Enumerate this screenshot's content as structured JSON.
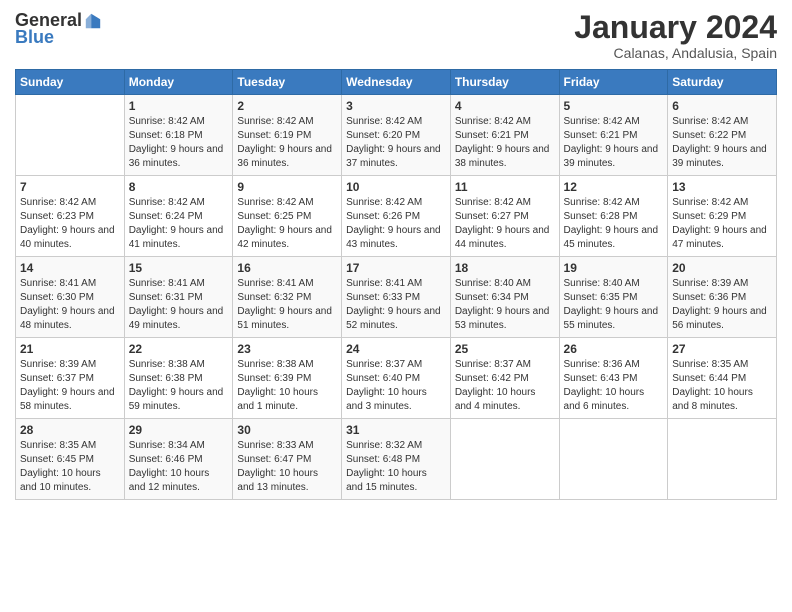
{
  "logo": {
    "general": "General",
    "blue": "Blue"
  },
  "title": "January 2024",
  "location": "Calanas, Andalusia, Spain",
  "weekdays": [
    "Sunday",
    "Monday",
    "Tuesday",
    "Wednesday",
    "Thursday",
    "Friday",
    "Saturday"
  ],
  "weeks": [
    [
      {
        "day": "",
        "empty": true
      },
      {
        "day": "1",
        "sunrise": "Sunrise: 8:42 AM",
        "sunset": "Sunset: 6:18 PM",
        "daylight": "Daylight: 9 hours and 36 minutes."
      },
      {
        "day": "2",
        "sunrise": "Sunrise: 8:42 AM",
        "sunset": "Sunset: 6:19 PM",
        "daylight": "Daylight: 9 hours and 36 minutes."
      },
      {
        "day": "3",
        "sunrise": "Sunrise: 8:42 AM",
        "sunset": "Sunset: 6:20 PM",
        "daylight": "Daylight: 9 hours and 37 minutes."
      },
      {
        "day": "4",
        "sunrise": "Sunrise: 8:42 AM",
        "sunset": "Sunset: 6:21 PM",
        "daylight": "Daylight: 9 hours and 38 minutes."
      },
      {
        "day": "5",
        "sunrise": "Sunrise: 8:42 AM",
        "sunset": "Sunset: 6:21 PM",
        "daylight": "Daylight: 9 hours and 39 minutes."
      },
      {
        "day": "6",
        "sunrise": "Sunrise: 8:42 AM",
        "sunset": "Sunset: 6:22 PM",
        "daylight": "Daylight: 9 hours and 39 minutes."
      }
    ],
    [
      {
        "day": "7",
        "sunrise": "Sunrise: 8:42 AM",
        "sunset": "Sunset: 6:23 PM",
        "daylight": "Daylight: 9 hours and 40 minutes."
      },
      {
        "day": "8",
        "sunrise": "Sunrise: 8:42 AM",
        "sunset": "Sunset: 6:24 PM",
        "daylight": "Daylight: 9 hours and 41 minutes."
      },
      {
        "day": "9",
        "sunrise": "Sunrise: 8:42 AM",
        "sunset": "Sunset: 6:25 PM",
        "daylight": "Daylight: 9 hours and 42 minutes."
      },
      {
        "day": "10",
        "sunrise": "Sunrise: 8:42 AM",
        "sunset": "Sunset: 6:26 PM",
        "daylight": "Daylight: 9 hours and 43 minutes."
      },
      {
        "day": "11",
        "sunrise": "Sunrise: 8:42 AM",
        "sunset": "Sunset: 6:27 PM",
        "daylight": "Daylight: 9 hours and 44 minutes."
      },
      {
        "day": "12",
        "sunrise": "Sunrise: 8:42 AM",
        "sunset": "Sunset: 6:28 PM",
        "daylight": "Daylight: 9 hours and 45 minutes."
      },
      {
        "day": "13",
        "sunrise": "Sunrise: 8:42 AM",
        "sunset": "Sunset: 6:29 PM",
        "daylight": "Daylight: 9 hours and 47 minutes."
      }
    ],
    [
      {
        "day": "14",
        "sunrise": "Sunrise: 8:41 AM",
        "sunset": "Sunset: 6:30 PM",
        "daylight": "Daylight: 9 hours and 48 minutes."
      },
      {
        "day": "15",
        "sunrise": "Sunrise: 8:41 AM",
        "sunset": "Sunset: 6:31 PM",
        "daylight": "Daylight: 9 hours and 49 minutes."
      },
      {
        "day": "16",
        "sunrise": "Sunrise: 8:41 AM",
        "sunset": "Sunset: 6:32 PM",
        "daylight": "Daylight: 9 hours and 51 minutes."
      },
      {
        "day": "17",
        "sunrise": "Sunrise: 8:41 AM",
        "sunset": "Sunset: 6:33 PM",
        "daylight": "Daylight: 9 hours and 52 minutes."
      },
      {
        "day": "18",
        "sunrise": "Sunrise: 8:40 AM",
        "sunset": "Sunset: 6:34 PM",
        "daylight": "Daylight: 9 hours and 53 minutes."
      },
      {
        "day": "19",
        "sunrise": "Sunrise: 8:40 AM",
        "sunset": "Sunset: 6:35 PM",
        "daylight": "Daylight: 9 hours and 55 minutes."
      },
      {
        "day": "20",
        "sunrise": "Sunrise: 8:39 AM",
        "sunset": "Sunset: 6:36 PM",
        "daylight": "Daylight: 9 hours and 56 minutes."
      }
    ],
    [
      {
        "day": "21",
        "sunrise": "Sunrise: 8:39 AM",
        "sunset": "Sunset: 6:37 PM",
        "daylight": "Daylight: 9 hours and 58 minutes."
      },
      {
        "day": "22",
        "sunrise": "Sunrise: 8:38 AM",
        "sunset": "Sunset: 6:38 PM",
        "daylight": "Daylight: 9 hours and 59 minutes."
      },
      {
        "day": "23",
        "sunrise": "Sunrise: 8:38 AM",
        "sunset": "Sunset: 6:39 PM",
        "daylight": "Daylight: 10 hours and 1 minute."
      },
      {
        "day": "24",
        "sunrise": "Sunrise: 8:37 AM",
        "sunset": "Sunset: 6:40 PM",
        "daylight": "Daylight: 10 hours and 3 minutes."
      },
      {
        "day": "25",
        "sunrise": "Sunrise: 8:37 AM",
        "sunset": "Sunset: 6:42 PM",
        "daylight": "Daylight: 10 hours and 4 minutes."
      },
      {
        "day": "26",
        "sunrise": "Sunrise: 8:36 AM",
        "sunset": "Sunset: 6:43 PM",
        "daylight": "Daylight: 10 hours and 6 minutes."
      },
      {
        "day": "27",
        "sunrise": "Sunrise: 8:35 AM",
        "sunset": "Sunset: 6:44 PM",
        "daylight": "Daylight: 10 hours and 8 minutes."
      }
    ],
    [
      {
        "day": "28",
        "sunrise": "Sunrise: 8:35 AM",
        "sunset": "Sunset: 6:45 PM",
        "daylight": "Daylight: 10 hours and 10 minutes."
      },
      {
        "day": "29",
        "sunrise": "Sunrise: 8:34 AM",
        "sunset": "Sunset: 6:46 PM",
        "daylight": "Daylight: 10 hours and 12 minutes."
      },
      {
        "day": "30",
        "sunrise": "Sunrise: 8:33 AM",
        "sunset": "Sunset: 6:47 PM",
        "daylight": "Daylight: 10 hours and 13 minutes."
      },
      {
        "day": "31",
        "sunrise": "Sunrise: 8:32 AM",
        "sunset": "Sunset: 6:48 PM",
        "daylight": "Daylight: 10 hours and 15 minutes."
      },
      {
        "day": "",
        "empty": true
      },
      {
        "day": "",
        "empty": true
      },
      {
        "day": "",
        "empty": true
      }
    ]
  ]
}
